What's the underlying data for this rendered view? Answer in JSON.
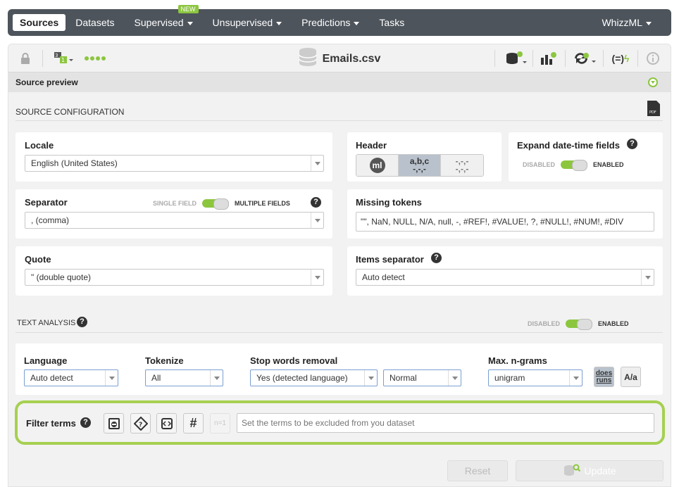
{
  "nav": {
    "items": [
      {
        "label": "Sources",
        "active": true
      },
      {
        "label": "Datasets"
      },
      {
        "label": "Supervised",
        "dropdown": true,
        "badge": "NEW"
      },
      {
        "label": "Unsupervised",
        "dropdown": true
      },
      {
        "label": "Predictions",
        "dropdown": true
      },
      {
        "label": "Tasks"
      }
    ],
    "user": "WhizzML"
  },
  "toolbar": {
    "title": "Emails.csv",
    "icons": [
      "lock-icon",
      "field-types-icon",
      "status-dots",
      "dataset-configure-icon",
      "model-configure-icon",
      "script-icon",
      "formula-icon",
      "info-icon"
    ]
  },
  "preview": {
    "label": "Source preview"
  },
  "source_config": {
    "title": "SOURCE CONFIGURATION",
    "pdf_label": "PDF",
    "locale": {
      "label": "Locale",
      "value": "English (United States)"
    },
    "separator": {
      "label": "Separator",
      "toggle_off": "SINGLE FIELD",
      "toggle_on": "MULTIPLE FIELDS",
      "value": ", (comma)"
    },
    "quote": {
      "label": "Quote",
      "value": "\" (double quote)"
    },
    "header": {
      "label": "Header",
      "options": [
        "ml",
        "a,b,c\n-,-,-",
        "-,-,-\n-,-,-"
      ]
    },
    "expand_datetime": {
      "label": "Expand date-time fields",
      "toggle_off": "DISABLED",
      "toggle_on": "ENABLED"
    },
    "missing_tokens": {
      "label": "Missing tokens",
      "value": "\"\", NaN, NULL, N/A, null, -, #REF!, #VALUE!, ?, #NULL!, #NUM!, #DIV"
    },
    "items_separator": {
      "label": "Items separator",
      "value": "Auto detect"
    }
  },
  "text_analysis": {
    "title": "TEXT ANALYSIS",
    "toggle_off": "DISABLED",
    "toggle_on": "ENABLED",
    "language": {
      "label": "Language",
      "value": "Auto detect"
    },
    "tokenize": {
      "label": "Tokenize",
      "value": "All"
    },
    "stop_words": {
      "label": "Stop words removal",
      "value": "Yes (detected language)",
      "level": "Normal"
    },
    "ngrams": {
      "label": "Max. n-grams",
      "value": "unigram"
    },
    "stem_btn": "does\nruns",
    "case_btn": "A/a"
  },
  "filter_terms": {
    "label": "Filter terms",
    "ngram_btn": "n=1",
    "placeholder": "Set the terms to be excluded from you dataset"
  },
  "actions": {
    "reset": "Reset",
    "update": "Update"
  },
  "colors": {
    "accent": "#8cc63f",
    "nav_bg": "#4d545c",
    "filter_border": "#a6d050"
  }
}
